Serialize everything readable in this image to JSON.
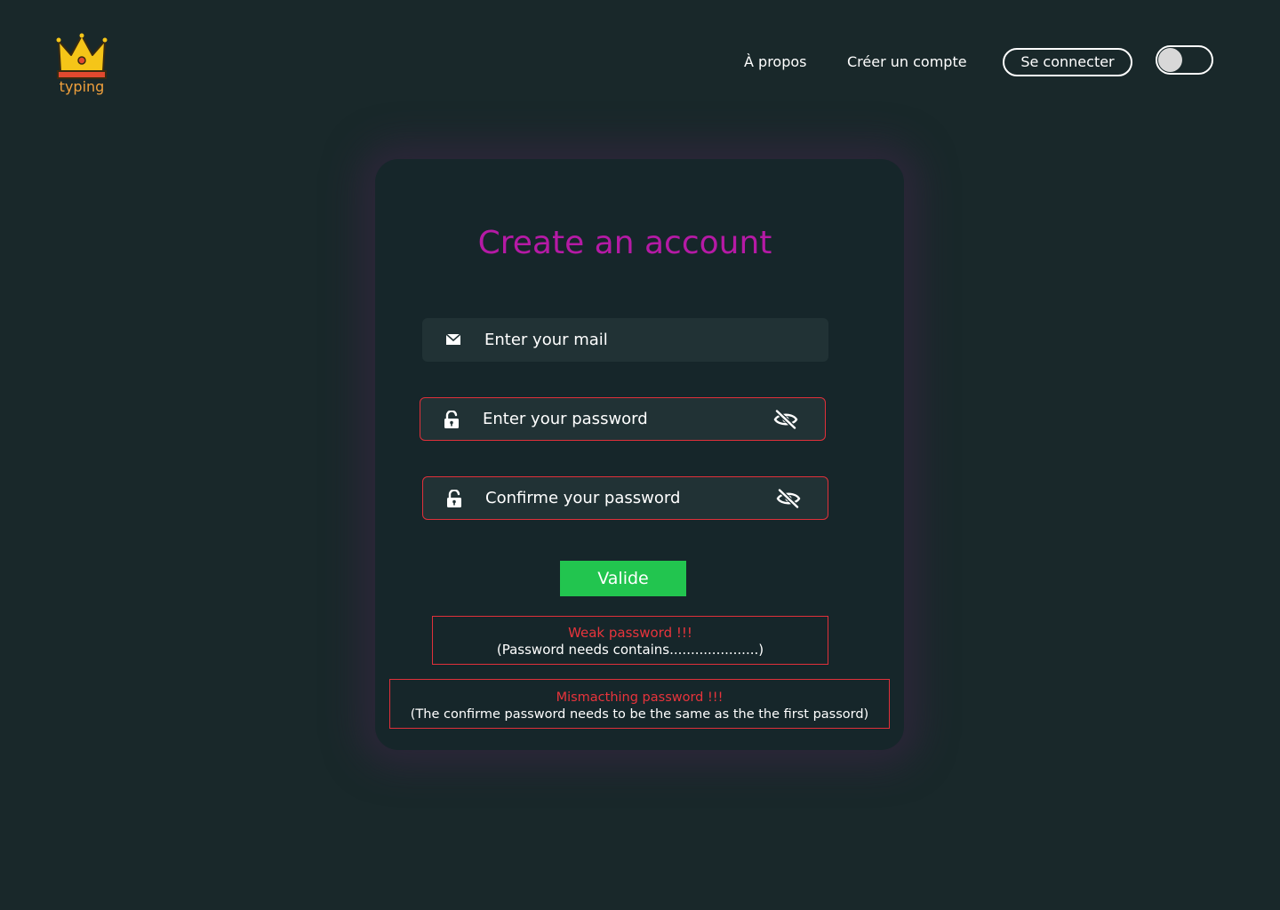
{
  "header": {
    "logo_text": "typing",
    "nav": {
      "about": "À propos",
      "register": "Créer un compte"
    },
    "login_button": "Se connecter",
    "theme_toggle": {
      "icon": "toggle-icon",
      "enabled": false
    }
  },
  "form": {
    "title": "Create an account",
    "mail": {
      "placeholder": "Enter your mail",
      "value": "",
      "icon": "envelope-icon"
    },
    "password": {
      "placeholder": "Enter your password",
      "value": "",
      "icon": "unlock-icon",
      "toggle_icon": "eye-slash-icon"
    },
    "confirm": {
      "placeholder": "Confirme your password",
      "value": "",
      "icon": "unlock-icon",
      "toggle_icon": "eye-slash-icon"
    },
    "submit_label": "Valide"
  },
  "errors": {
    "weak": {
      "title": "Weak password !!!",
      "detail": "(Password needs contains.....................)"
    },
    "mismatch": {
      "title": "Mismacthing password !!!",
      "detail": "(The confirme password needs to be the same as the the first passord)"
    }
  },
  "colors": {
    "background": "#19282a",
    "card": "#16262a",
    "field": "#213235",
    "title": "#b51aa5",
    "error": "#e0303a",
    "submit": "#22c54f",
    "logo": "#f0a03c"
  }
}
